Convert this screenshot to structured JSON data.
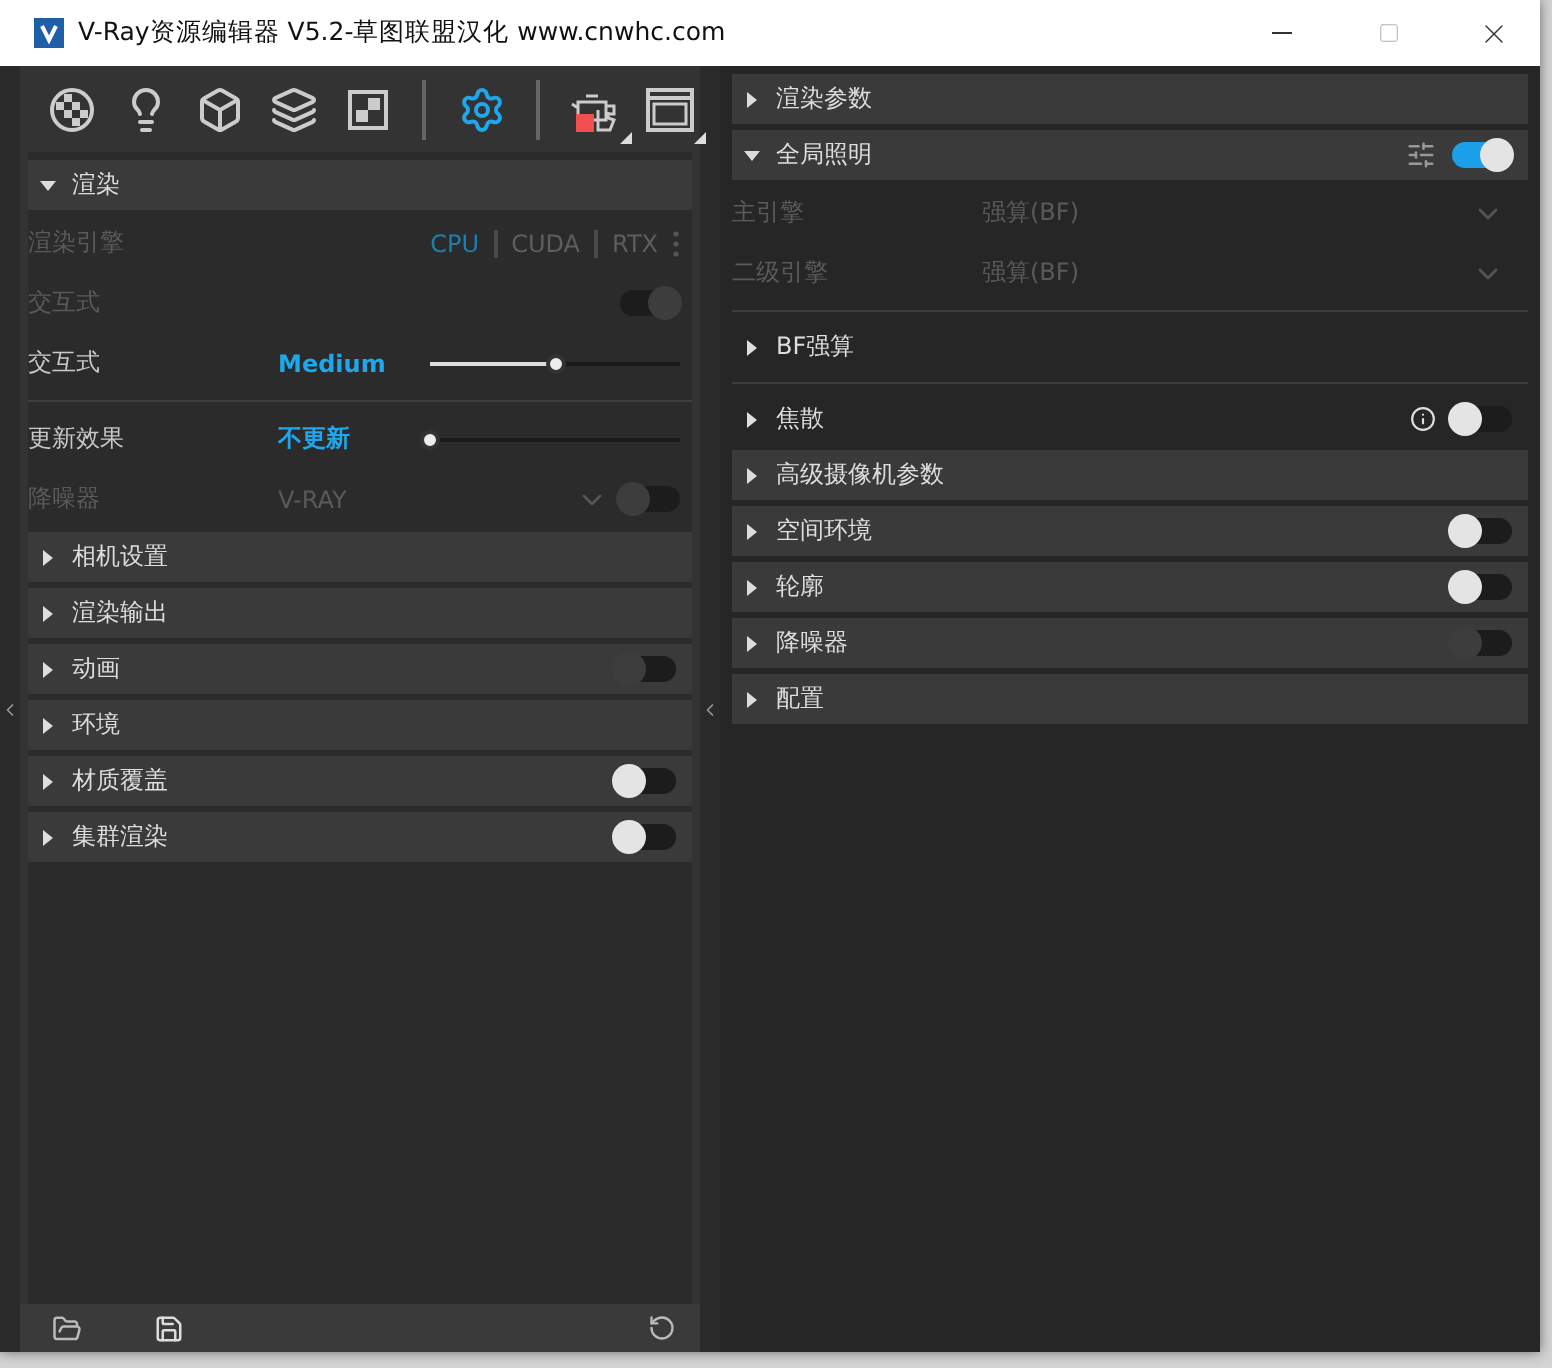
{
  "window": {
    "title": "V-Ray资源编辑器 V5.2-草图联盟汉化 www.cnwhc.com"
  },
  "toolbar": {
    "tools": [
      {
        "kind": "materials",
        "selected": false
      },
      {
        "kind": "lights",
        "selected": false
      },
      {
        "kind": "geometry",
        "selected": false
      },
      {
        "kind": "layers",
        "selected": false
      },
      {
        "kind": "textures",
        "selected": false
      },
      {
        "kind": "settings",
        "selected": true
      },
      {
        "kind": "render",
        "selected": false
      },
      {
        "kind": "window",
        "selected": false
      }
    ]
  },
  "left_panel": {
    "sections": [
      {
        "title": "渲染",
        "expanded": true,
        "rows": [
          {
            "kind": "engine",
            "label": "渲染引擎",
            "disabled": true,
            "options": [
              {
                "label": "CPU",
                "selected": true
              },
              {
                "label": "CUDA",
                "selected": false
              },
              {
                "label": "RTX",
                "selected": false
              }
            ]
          },
          {
            "kind": "toggle",
            "label": "交互式",
            "disabled": true,
            "on": true
          },
          {
            "kind": "slider",
            "label": "交互式",
            "disabled": false,
            "value": "Medium",
            "level": 0.5
          },
          {
            "kind": "divider"
          },
          {
            "kind": "slider",
            "label": "更新效果",
            "disabled": false,
            "value": "不更新",
            "level": 0.0
          },
          {
            "kind": "dropdown",
            "label": "降噪器",
            "disabled": true,
            "value": "V-RAY",
            "toggle": {
              "on": false,
              "disabled": true
            }
          }
        ]
      },
      {
        "title": "相机设置",
        "expanded": false
      },
      {
        "title": "渲染输出",
        "expanded": false
      },
      {
        "title": "动画",
        "expanded": false,
        "toggle": {
          "on": false,
          "disabled": true
        }
      },
      {
        "title": "环境",
        "expanded": false
      },
      {
        "title": "材质覆盖",
        "expanded": false,
        "toggle": {
          "on": false,
          "disabled": false
        }
      },
      {
        "title": "集群渲染",
        "expanded": false,
        "toggle": {
          "on": false,
          "disabled": false
        }
      }
    ]
  },
  "right_panel": {
    "sections": [
      {
        "title": "渲染参数",
        "expanded": false
      },
      {
        "title": "全局照明",
        "expanded": true,
        "settings_icon": true,
        "toggle": {
          "on": true,
          "disabled": false
        },
        "rows": [
          {
            "kind": "dropdown",
            "label": "主引擎",
            "disabled": true,
            "value": "强算(BF)"
          },
          {
            "kind": "dropdown",
            "label": "二级引擎",
            "disabled": true,
            "value": "强算(BF)"
          },
          {
            "kind": "divider"
          },
          {
            "kind": "subsection",
            "label": "BF强算"
          },
          {
            "kind": "divider"
          },
          {
            "kind": "subsection",
            "label": "焦散",
            "info_icon": true,
            "toggle": {
              "on": false,
              "disabled": false
            }
          }
        ]
      },
      {
        "title": "高级摄像机参数",
        "expanded": false
      },
      {
        "title": "空间环境",
        "expanded": false,
        "toggle": {
          "on": false,
          "disabled": false
        }
      },
      {
        "title": "轮廓",
        "expanded": false,
        "toggle": {
          "on": false,
          "disabled": false
        }
      },
      {
        "title": "降噪器",
        "expanded": false,
        "toggle": {
          "on": false,
          "disabled": true
        }
      },
      {
        "title": "配置",
        "expanded": false
      }
    ]
  }
}
